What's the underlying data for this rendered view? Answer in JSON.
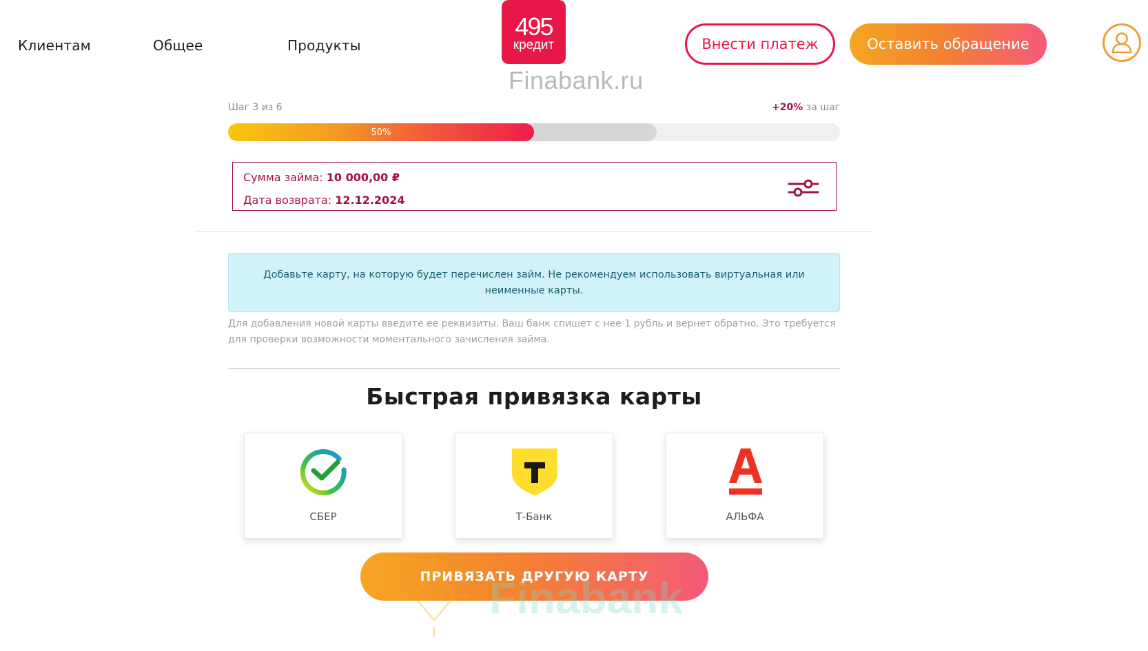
{
  "nav": {
    "items": [
      {
        "label": "Клиентам"
      },
      {
        "label": "Общее"
      },
      {
        "label": "Продукты"
      }
    ]
  },
  "logo": {
    "number": "495",
    "word": "кредит"
  },
  "watermark": {
    "top": "Finabank.ru",
    "bottom": "Finabank"
  },
  "header": {
    "pay_label": "Внести платеж",
    "appeal_label": "Оставить обращение"
  },
  "progress": {
    "step_text": "Шаг 3 из 6",
    "bonus_value": "+20%",
    "bonus_suffix": " за шаг",
    "percent_label": "50%",
    "fill_fraction": 0.5,
    "next_fraction": 0.7
  },
  "loan": {
    "amount_label": "Сумма займа: ",
    "amount_value": "10 000,00 ₽",
    "date_label": "Дата возврата: ",
    "date_value": "12.12.2024"
  },
  "info": {
    "message": "Добавьте карту, на которую будет перечислен займ. Не рекомендуем использовать виртуальная или неименные карты.",
    "hint": "Для добавления новой карты введите ее реквизиты. Ваш банк спишет с нее 1 рубль и вернет обратно. Это требуется для проверки возможности моментального зачисления займа."
  },
  "quick_bind": {
    "title": "Быстрая привязка карты",
    "banks": [
      {
        "name": "СБЕР",
        "icon": "sber-icon"
      },
      {
        "name": "Т-Банк",
        "icon": "tbank-icon"
      },
      {
        "name": "АЛЬФА",
        "icon": "alfa-icon"
      }
    ],
    "other_card_label": "ПРИВЯЗАТЬ ДРУГУЮ КАРТУ"
  },
  "colors": {
    "brand": "#e8174a",
    "accent_dark": "#a4113c",
    "gradient_start": "#f5a623",
    "gradient_end": "#f45a78",
    "info_bg": "#d0f2f8"
  }
}
